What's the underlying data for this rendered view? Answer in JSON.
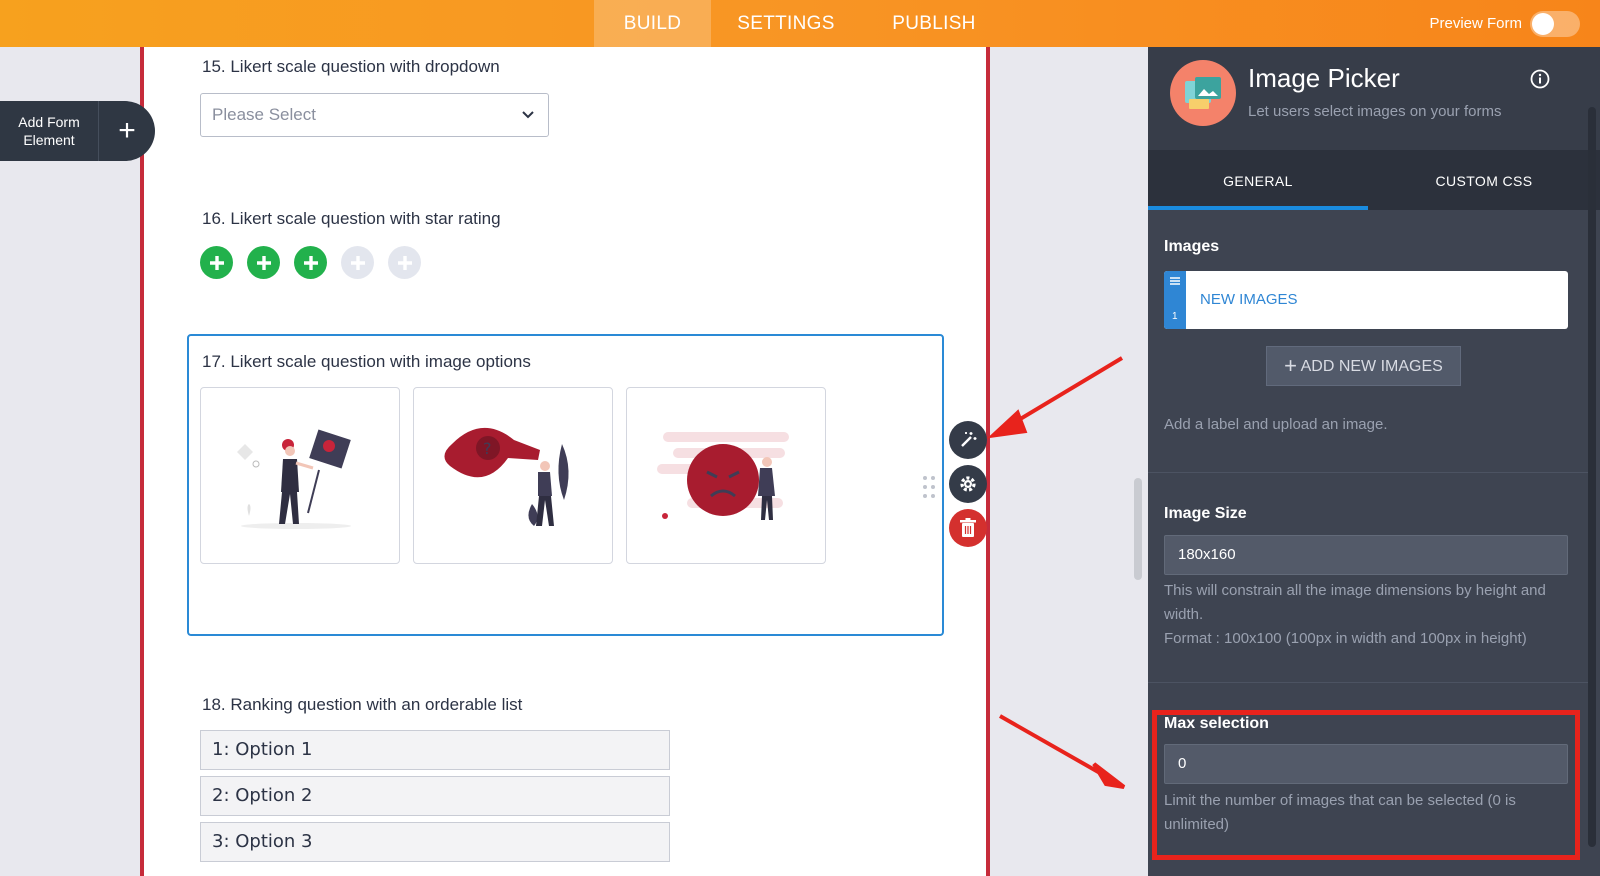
{
  "topbar": {
    "tabs": [
      "BUILD",
      "SETTINGS",
      "PUBLISH"
    ],
    "preview_label": "Preview Form"
  },
  "add_element": {
    "label": "Add Form Element"
  },
  "form": {
    "q15": {
      "label": "15. Likert scale question with dropdown",
      "placeholder": "Please Select"
    },
    "q16": {
      "label": "16. Likert scale question with star rating",
      "rating_value": 3,
      "rating_max": 5
    },
    "q17": {
      "label": "17. Likert scale question with image options"
    },
    "q18": {
      "label": "18. Ranking question with an orderable list",
      "options": [
        "1: Option 1",
        "2: Option 2",
        "3: Option 3"
      ]
    }
  },
  "panel": {
    "title": "Image Picker",
    "subtitle": "Let users select images on your forms",
    "tabs": [
      "GENERAL",
      "CUSTOM CSS"
    ],
    "images": {
      "label": "Images",
      "item_text": "NEW IMAGES",
      "item_index": "1",
      "add_button": "ADD NEW IMAGES",
      "help": "Add a label and upload an image."
    },
    "image_size": {
      "label": "Image Size",
      "value": "180x160",
      "help1": "This will constrain all the image dimensions by height and width.",
      "help2": "Format : 100x100 (100px in width and 100px in height)"
    },
    "max_selection": {
      "label": "Max selection",
      "value": "0",
      "help": "Limit the number of images that can be selected (0 is unlimited)"
    }
  },
  "colors": {
    "accent_orange": "#f89524",
    "selected_blue": "#2a8ad6",
    "star_green": "#22b14c",
    "annotation_red": "#e8231c",
    "panel_bg": "#3e4451"
  }
}
